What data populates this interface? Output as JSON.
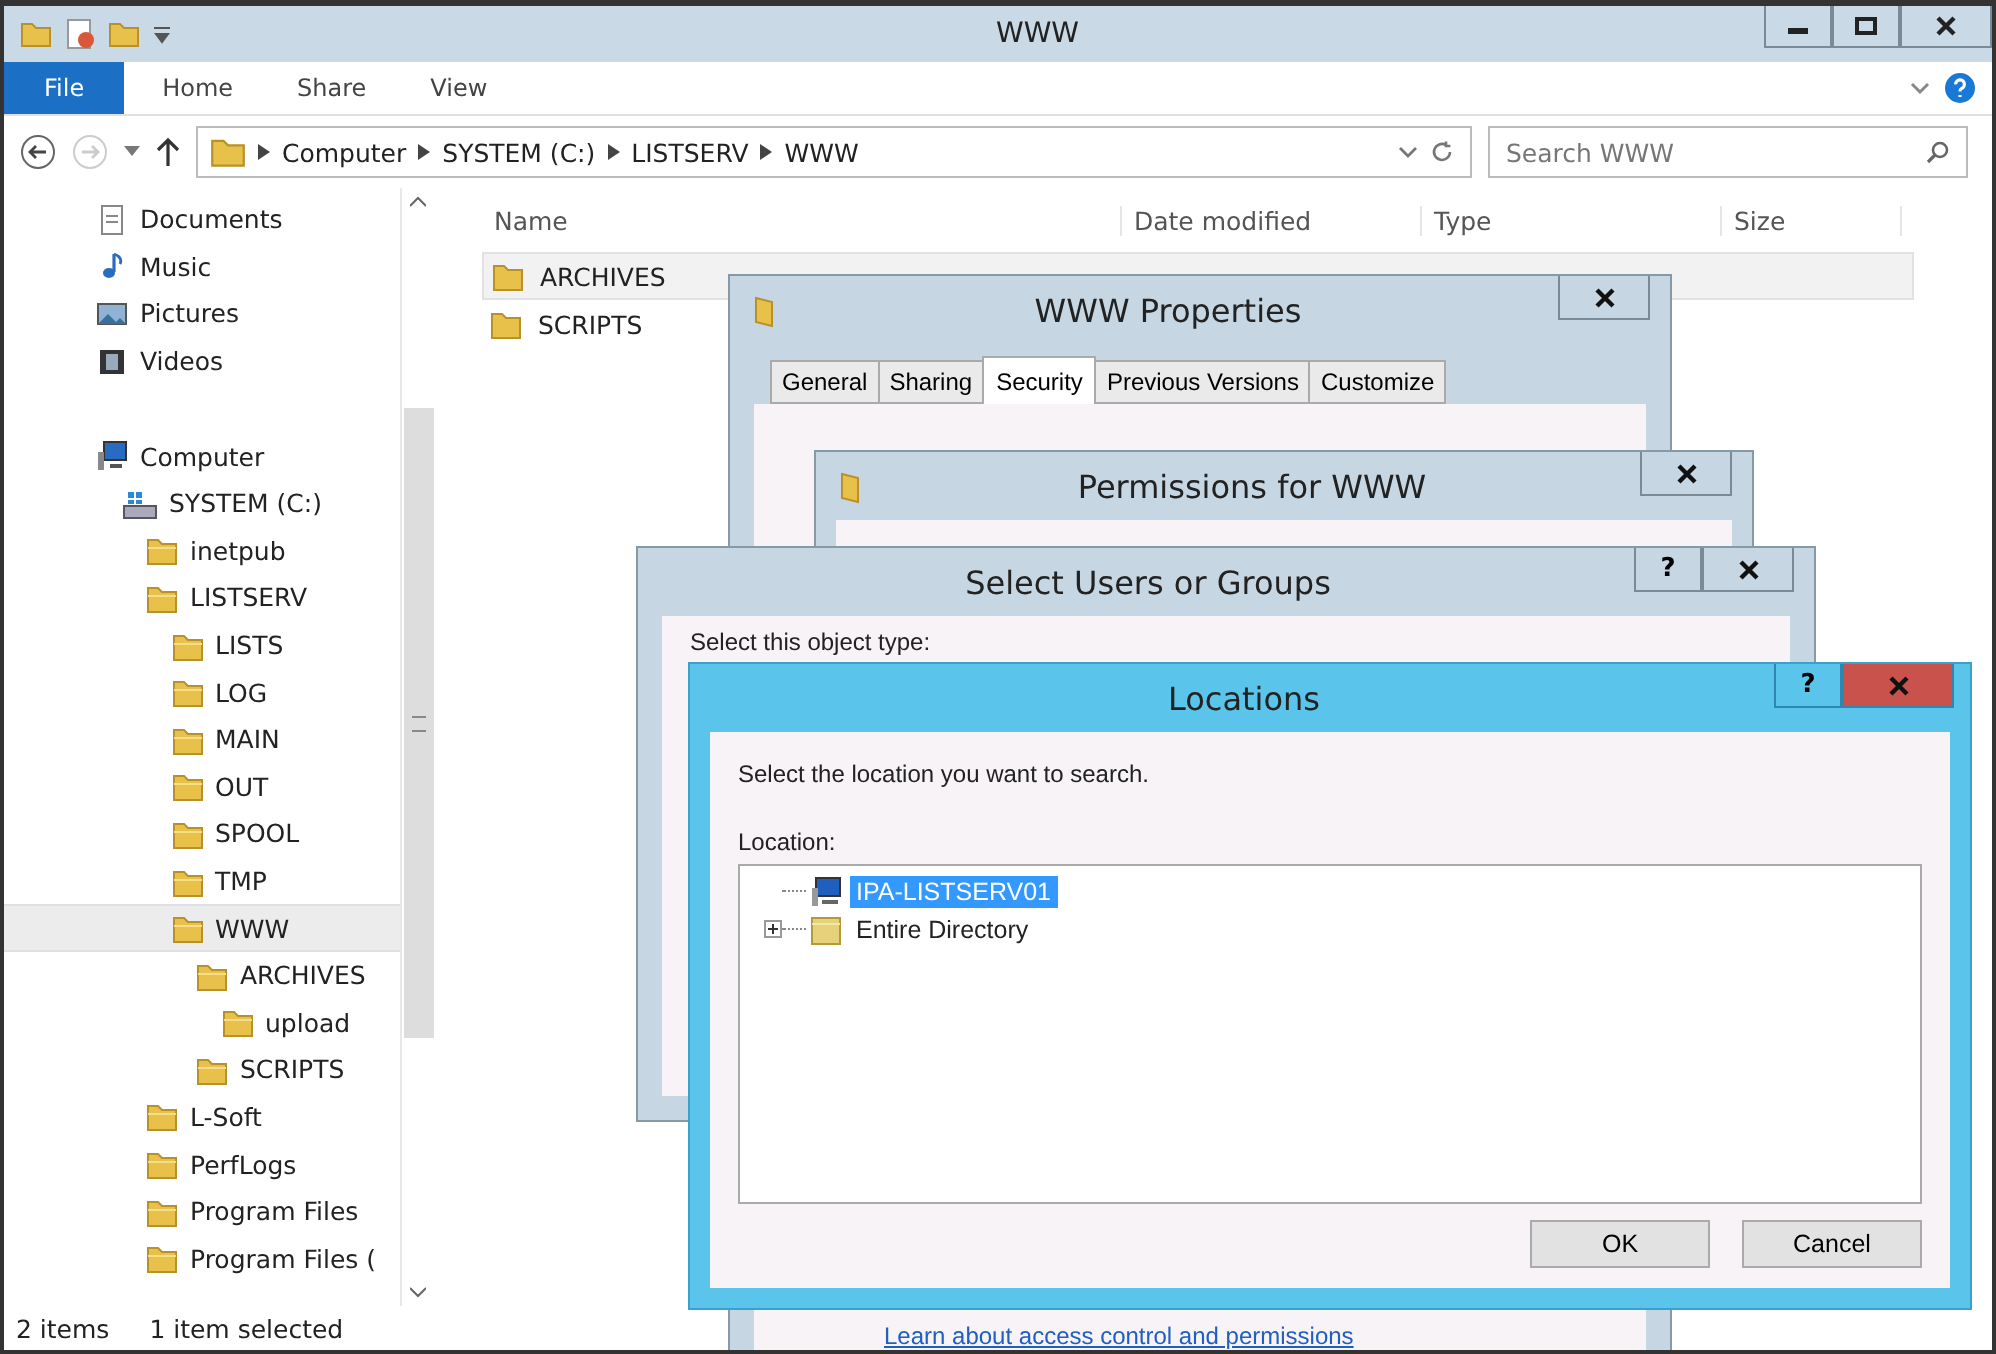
{
  "window": {
    "title": "WWW"
  },
  "ribbon": {
    "tabs": [
      {
        "label": "File",
        "selected": true
      },
      {
        "label": "Home",
        "selected": false
      },
      {
        "label": "Share",
        "selected": false
      },
      {
        "label": "View",
        "selected": false
      }
    ]
  },
  "address": {
    "path": [
      "Computer",
      "SYSTEM (C:)",
      "LISTSERV",
      "WWW"
    ]
  },
  "search": {
    "placeholder": "Search WWW"
  },
  "navigation": {
    "items": [
      {
        "label": "Documents",
        "kind": "document",
        "selected": false
      },
      {
        "label": "Music",
        "kind": "music",
        "selected": false
      },
      {
        "label": "Pictures",
        "kind": "pictures",
        "selected": false
      },
      {
        "label": "Videos",
        "kind": "videos",
        "selected": false
      },
      {
        "label": "Computer",
        "kind": "computer",
        "selected": false,
        "children": [
          {
            "label": "SYSTEM (C:)",
            "kind": "drive",
            "selected": false,
            "children": [
              {
                "label": "inetpub",
                "kind": "folder",
                "selected": false
              },
              {
                "label": "LISTSERV",
                "kind": "folder",
                "selected": false,
                "children": [
                  {
                    "label": "LISTS",
                    "kind": "folder",
                    "selected": false
                  },
                  {
                    "label": "LOG",
                    "kind": "folder",
                    "selected": false
                  },
                  {
                    "label": "MAIN",
                    "kind": "folder",
                    "selected": false
                  },
                  {
                    "label": "OUT",
                    "kind": "folder",
                    "selected": false
                  },
                  {
                    "label": "SPOOL",
                    "kind": "folder",
                    "selected": false
                  },
                  {
                    "label": "TMP",
                    "kind": "folder",
                    "selected": false
                  },
                  {
                    "label": "WWW",
                    "kind": "folder",
                    "selected": true,
                    "children": [
                      {
                        "label": "ARCHIVES",
                        "kind": "folder",
                        "selected": false,
                        "children": [
                          {
                            "label": "upload",
                            "kind": "folder",
                            "selected": false
                          }
                        ]
                      },
                      {
                        "label": "SCRIPTS",
                        "kind": "folder",
                        "selected": false
                      }
                    ]
                  }
                ]
              },
              {
                "label": "L-Soft",
                "kind": "folder",
                "selected": false
              },
              {
                "label": "PerfLogs",
                "kind": "folder",
                "selected": false
              },
              {
                "label": "Program Files",
                "kind": "folder",
                "selected": false
              },
              {
                "label": "Program Files (",
                "kind": "folder",
                "selected": false
              }
            ]
          }
        ]
      }
    ]
  },
  "file_list": {
    "columns": [
      "Name",
      "Date modified",
      "Type",
      "Size"
    ],
    "rows": [
      {
        "name": "ARCHIVES",
        "selected": true
      },
      {
        "name": "SCRIPTS",
        "selected": false
      }
    ]
  },
  "status_bar": {
    "item_count": "2 items",
    "selection": "1 item selected"
  },
  "dialogs": [
    {
      "kind": "properties",
      "title": "WWW Properties",
      "tabs": [
        {
          "label": "General",
          "selected": false
        },
        {
          "label": "Sharing",
          "selected": false
        },
        {
          "label": "Security",
          "selected": true
        },
        {
          "label": "Previous Versions",
          "selected": false
        },
        {
          "label": "Customize",
          "selected": false
        }
      ],
      "link": "Learn about access control and permissions"
    },
    {
      "kind": "permissions",
      "title": "Permissions for WWW"
    },
    {
      "kind": "select_users",
      "title": "Select Users or Groups",
      "help": "?",
      "label": "Select this object type:"
    },
    {
      "kind": "locations",
      "title": "Locations",
      "help": "?",
      "prompt": "Select the location you want to search.",
      "field_label": "Location:",
      "tree": [
        {
          "label": "IPA-LISTSERV01",
          "kind": "computer",
          "selected": true,
          "expandable": false
        },
        {
          "label": "Entire Directory",
          "kind": "directory",
          "selected": false,
          "expandable": true
        }
      ],
      "buttons": [
        "OK",
        "Cancel"
      ]
    }
  ]
}
